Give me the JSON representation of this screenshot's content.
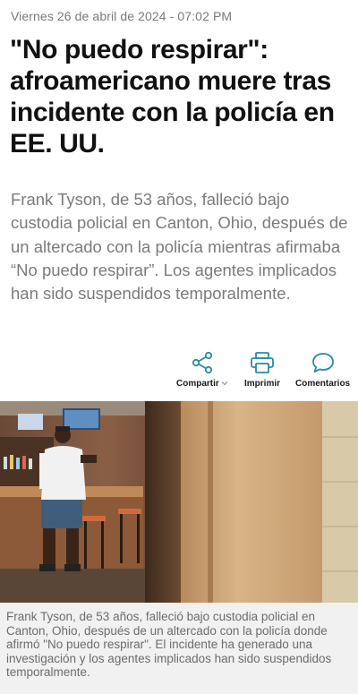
{
  "article": {
    "date": "Viernes 26 de abril de 2024 - 07:02 PM",
    "headline": "\"No puedo respirar\": afroamericano muere tras incidente con la policía en EE. UU.",
    "lede": "Frank Tyson, de 53 años, falleció bajo custodia policial en Canton, Ohio, después de un altercado con la policía mientras afirmaba “No puedo respirar”. Los agentes implicados han sido suspendidos temporalmente."
  },
  "actions": {
    "share_label": "Compartir",
    "print_label": "Imprimir",
    "comments_label": "Comentarios",
    "icon_color": "#2a8aa6"
  },
  "photo": {
    "caption": "Frank Tyson, de 53 años, falleció bajo custodia policial en Canton, Ohio, después de un altercado con la policía donde afirmó \"No puedo respirar\". El incidente ha generado una investigación y los agentes implicados han sido suspendidos temporalmente."
  }
}
